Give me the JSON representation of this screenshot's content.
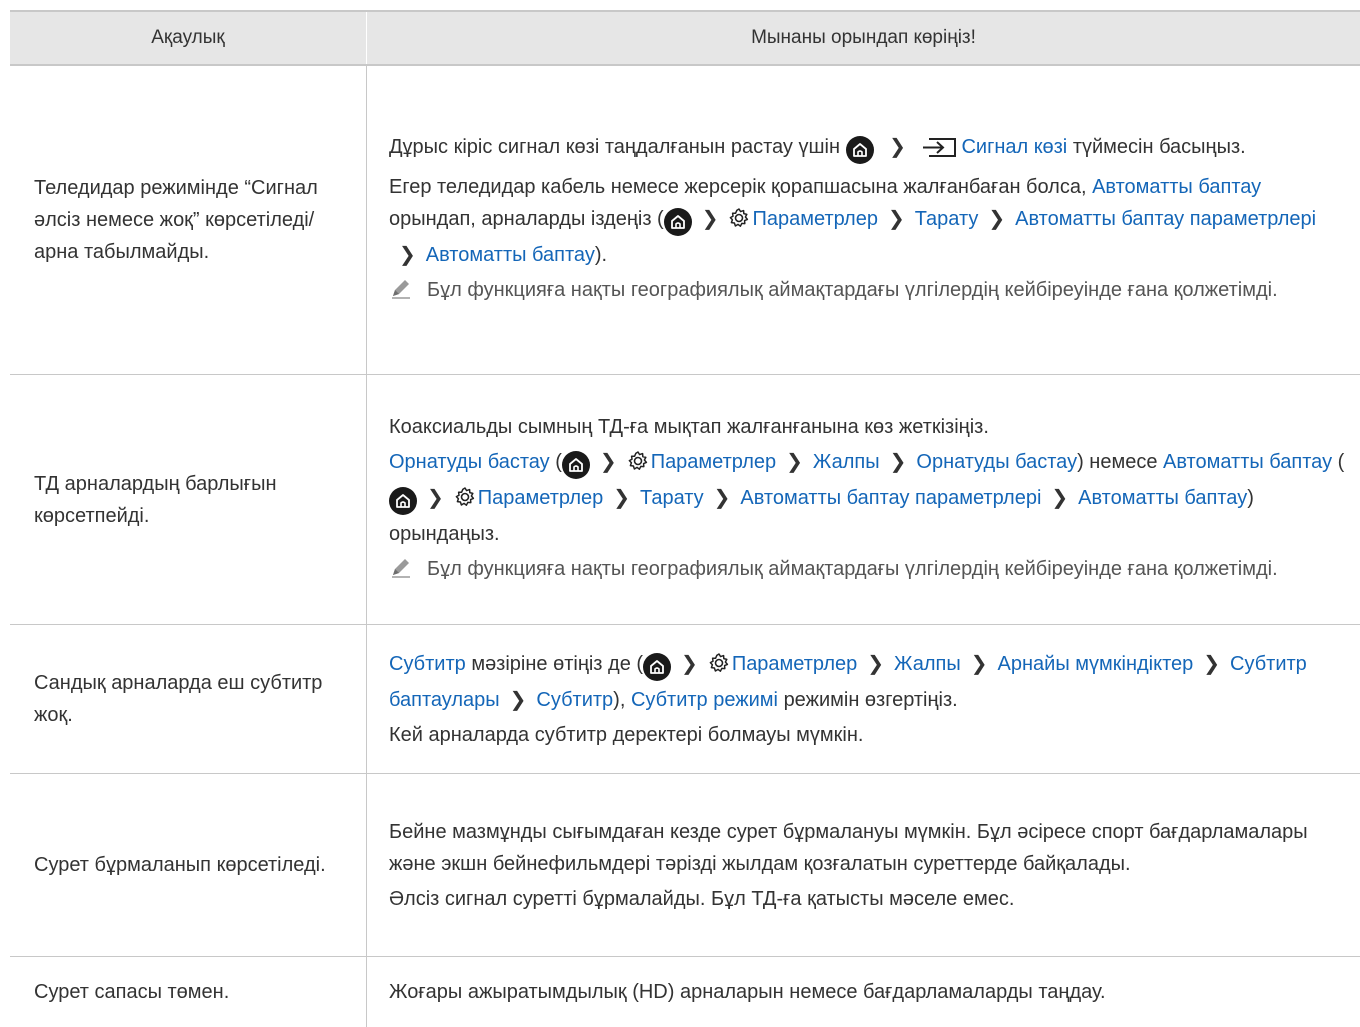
{
  "header": {
    "problem": "Ақаулық",
    "solution": "Мынаны орындап көріңіз!"
  },
  "rows": [
    {
      "problem": "Теледидар режимінде “Сигнал әлсіз немесе жоқ” көрсетіледі/арна табылмайды.",
      "s1": {
        "pre": "Дұрыс кіріс сигнал көзі таңдалғанын растау үшін",
        "link": "Сигнал көзі",
        "post": "түймесін басыңыз."
      },
      "s2": {
        "pre": "Егер теледидар кабель немесе жерсерік қорапшасына жалғанбаған болса,",
        "link1": "Автоматты баптау",
        "mid": "орындап, арналарды іздеңіз (",
        "l_params": "Параметрлер",
        "l_broadcast": "Тарату",
        "l_autoparams": "Автоматты баптау параметрлері",
        "l_auto": "Автоматты баптау",
        "end": ")."
      },
      "note": "Бұл функцияға нақты географиялық аймақтардағы үлгілердің кейбіреуінде ғана қолжетімді."
    },
    {
      "problem": "ТД арналардың барлығын көрсетпейді.",
      "s1": "Коаксиальды сымның ТД-ға мықтап жалғанғанына көз жеткізіңіз.",
      "s2": {
        "l_setup": "Орнатуды бастау",
        "l_params": "Параметрлер",
        "l_general": "Жалпы",
        "l_setup2": "Орнатуды бастау",
        "or": ") немесе",
        "l_auto": "Автоматты баптау",
        "l_params2": "Параметрлер",
        "l_broadcast": "Тарату",
        "l_autoparams": "Автоматты баптау параметрлері",
        "l_auto2": "Автоматты баптау",
        "end": ") орындаңыз."
      },
      "note": "Бұл функцияға нақты географиялық аймақтардағы үлгілердің кейбіреуінде ғана қолжетімді."
    },
    {
      "problem": "Сандық арналарда еш субтитр жоқ.",
      "s1": {
        "l_sub": "Субтитр",
        "mid": "мәзіріне өтіңіз де (",
        "l_params": "Параметрлер",
        "l_general": "Жалпы",
        "l_access": "Арнайы мүмкіндіктер",
        "l_subsettings": "Субтитр баптаулары",
        "l_sub2": "Субтитр",
        "sep": "),",
        "l_submode": "Субтитр режимі",
        "end": "режимін өзгертіңіз."
      },
      "s2": "Кей арналарда субтитр деректері болмауы мүмкін."
    },
    {
      "problem": "Сурет бұрмаланып көрсетіледі.",
      "s1": "Бейне мазмұнды сығымдаған кезде сурет бұрмалануы мүмкін. Бұл әсіресе спорт бағдарламалары және экшн бейнефильмдері тәрізді жылдам қозғалатын суреттерде байқалады.",
      "s2": "Әлсіз сигнал суретті бұрмалайды. Бұл ТД-ға қатысты мәселе емес."
    },
    {
      "problem": "Сурет сапасы төмен.",
      "s1": "Жоғары ажыратымдылық (HD) арналарын немесе бағдарламаларды таңдау."
    }
  ],
  "symbols": {
    "chevron": "❯",
    "open_paren": "(",
    "close_paren": ")"
  },
  "colors": {
    "link": "#1466b8",
    "header_bg": "#e6e6e6",
    "border": "#c8c8c8"
  }
}
